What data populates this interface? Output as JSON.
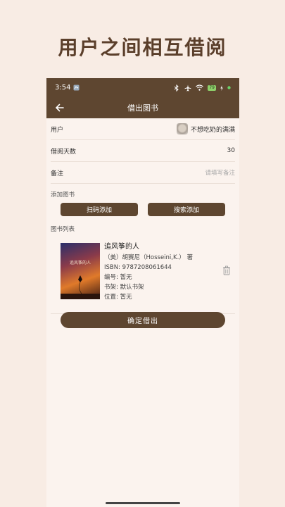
{
  "headline": "用户之间相互借阅",
  "status_bar": {
    "time": "3:54",
    "battery": "79"
  },
  "app_bar": {
    "title": "借出图书"
  },
  "form": {
    "user_label": "用户",
    "user_value": "不想吃奶的满满",
    "days_label": "借阅天数",
    "days_value": "30",
    "remark_label": "备注",
    "remark_placeholder": "请填写备注"
  },
  "add_section": {
    "label": "添加图书",
    "scan_button": "扫码添加",
    "search_button": "搜索添加"
  },
  "book_list": {
    "label": "图书列表",
    "items": [
      {
        "title": "追风筝的人",
        "author": "（美）胡赛尼（Hosseini,K.） 著",
        "isbn": "ISBN: 9787208061644",
        "number": "编号: 暂无",
        "shelf": "书架: 默认书架",
        "location": "位置: 暂无",
        "cover_title": "追风筝的人"
      }
    ]
  },
  "confirm_button": "确定借出",
  "colors": {
    "primary": "#5e4630",
    "background": "#f8ece4",
    "headline": "#5b3f2b"
  }
}
